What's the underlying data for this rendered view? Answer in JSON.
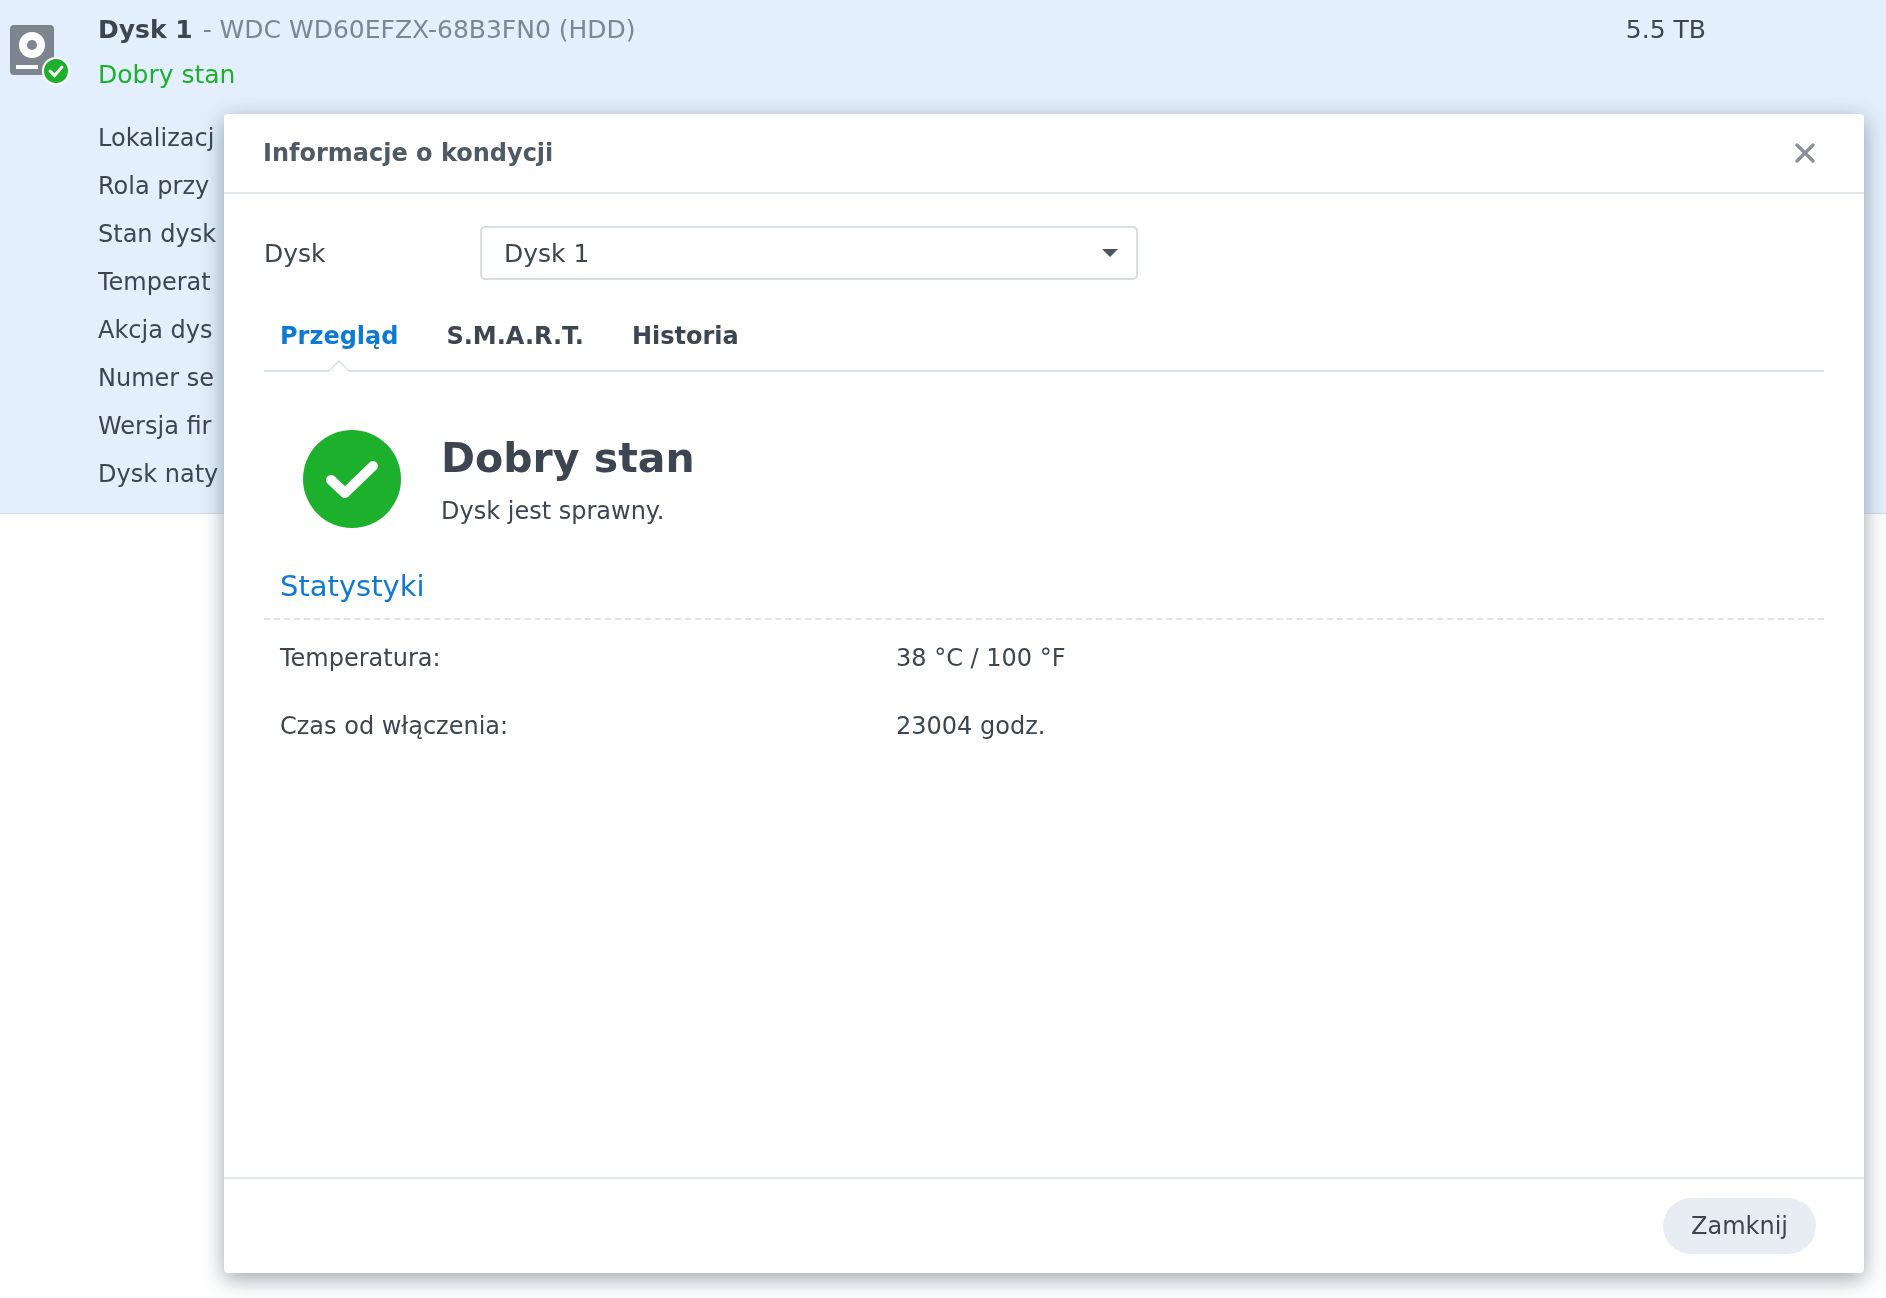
{
  "disk": {
    "name": "Dysk 1",
    "model": "- WDC WD60EFZX-68B3FN0 (HDD)",
    "status": "Dobry stan",
    "healthy": true,
    "size": "5.5 TB",
    "detail_labels": [
      "Lokalizacj",
      "Rola przy",
      "Stan dysk",
      "Temperat",
      "Akcja dys",
      "Numer se",
      "Wersja fir",
      "Dysk naty"
    ]
  },
  "dialog": {
    "title": "Informacje o kondycji",
    "disk_field": {
      "label": "Dysk",
      "value": "Dysk 1"
    },
    "tabs": [
      {
        "label": "Przegląd",
        "selected": true
      },
      {
        "label": "S.M.A.R.T.",
        "selected": false
      },
      {
        "label": "Historia",
        "selected": false
      }
    ],
    "health": {
      "healthy": true,
      "title": "Dobry stan",
      "description": "Dysk jest sprawny."
    },
    "section_title": "Statystyki",
    "stats": [
      {
        "label": "Temperatura:",
        "value": "38 °C / 100 °F"
      },
      {
        "label": "Czas od włączenia:",
        "value": "23004 godz."
      }
    ],
    "buttons": [
      "Zamknij"
    ]
  }
}
